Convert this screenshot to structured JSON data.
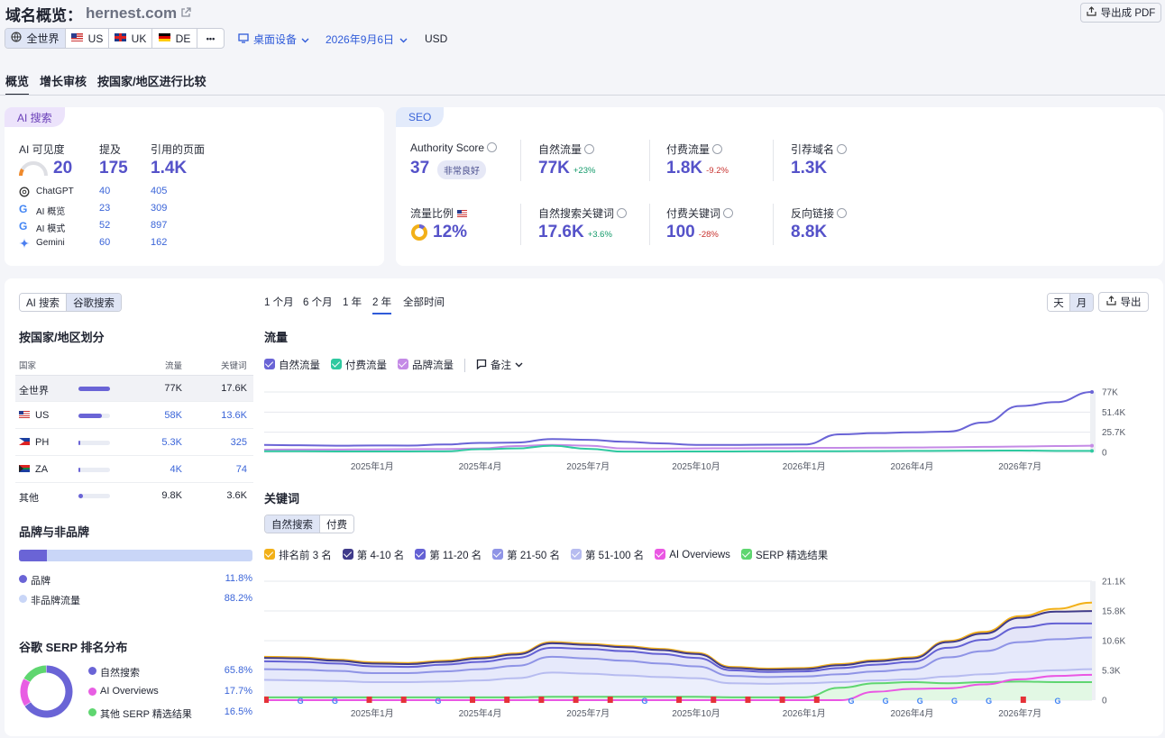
{
  "header": {
    "title": "域名概览：",
    "domain": "hernest.com",
    "export_pdf": "导出成 PDF",
    "regions": [
      "全世界",
      "US",
      "UK",
      "DE"
    ],
    "more": "•••",
    "device": "桌面设备",
    "date": "2026年9月6日",
    "currency": "USD"
  },
  "tabs": [
    "概览",
    "增长审核",
    "按国家/地区进行比较"
  ],
  "ai_card": {
    "tag": "AI 搜索",
    "col_visibility": "AI 可见度",
    "col_mentions": "提及",
    "col_pages": "引用的页面",
    "visibility": "20",
    "mentions": "175",
    "pages": "1.4K",
    "rows": [
      {
        "name": "ChatGPT",
        "mentions": "40",
        "pages": "405"
      },
      {
        "name": "AI 概览",
        "mentions": "23",
        "pages": "309"
      },
      {
        "name": "AI 模式",
        "mentions": "52",
        "pages": "897"
      },
      {
        "name": "Gemini",
        "mentions": "60",
        "pages": "162"
      }
    ]
  },
  "seo_card": {
    "tag": "SEO",
    "authority_label": "Authority Score",
    "authority_value": "37",
    "authority_badge": "非常良好",
    "organic_label": "自然流量",
    "organic_value": "77K",
    "organic_delta": "+23%",
    "paid_label": "付费流量",
    "paid_value": "1.8K",
    "paid_delta": "-9.2%",
    "refdomains_label": "引荐域名",
    "refdomains_value": "1.3K",
    "share_label": "流量比例",
    "share_value": "12%",
    "share_fraction": 0.12,
    "org_kw_label": "自然搜索关键词",
    "org_kw_value": "17.6K",
    "org_kw_delta": "+3.6%",
    "paid_kw_label": "付费关键词",
    "paid_kw_value": "100",
    "paid_kw_delta": "-28%",
    "backlinks_label": "反向链接",
    "backlinks_value": "8.8K"
  },
  "left_panel": {
    "toggle": [
      "AI 搜索",
      "谷歌搜索"
    ],
    "country_title": "按国家/地区划分",
    "col_country": "国家",
    "col_traffic": "流量",
    "col_keywords": "关键词",
    "countries": [
      {
        "name": "全世界",
        "traffic": "77K",
        "keywords": "17.6K",
        "share": 1.0
      },
      {
        "name": "US",
        "traffic": "58K",
        "keywords": "13.6K",
        "share": 0.75
      },
      {
        "name": "PH",
        "traffic": "5.3K",
        "keywords": "325",
        "share": 0.07
      },
      {
        "name": "ZA",
        "traffic": "4K",
        "keywords": "74",
        "share": 0.05
      },
      {
        "name": "其他",
        "traffic": "9.8K",
        "keywords": "3.6K",
        "share": 0.13
      }
    ],
    "brand_title": "品牌与非品牌",
    "brand_label": "品牌",
    "brand_value": "11.8%",
    "brand_fraction": 0.118,
    "nonbrand_label": "非品牌流量",
    "nonbrand_value": "88.2%",
    "serp_title": "谷歌 SERP 排名分布",
    "serp_items": [
      {
        "label": "自然搜索",
        "value": "65.8%",
        "fraction": 0.658,
        "color": "#6a64d6"
      },
      {
        "label": "AI Overviews",
        "value": "17.7%",
        "fraction": 0.177,
        "color": "#e85ee3"
      },
      {
        "label": "其他 SERP 精选结果",
        "value": "16.5%",
        "fraction": 0.165,
        "color": "#5fd670"
      }
    ]
  },
  "right_panel": {
    "ranges": [
      "1 个月",
      "6 个月",
      "1 年",
      "2 年",
      "全部时间"
    ],
    "active_range": "2 年",
    "gran_day": "天",
    "gran_month": "月",
    "export": "导出",
    "traffic_title": "流量",
    "traffic_legend": [
      "自然流量",
      "付费流量",
      "品牌流量"
    ],
    "notes": "备注",
    "kw_title": "关键词",
    "kw_toggle": [
      "自然搜索",
      "付费"
    ],
    "kw_legend": [
      "排名前 3 名",
      "第 4-10 名",
      "第 11-20 名",
      "第 21-50 名",
      "第 51-100 名",
      "AI Overviews",
      "SERP 精选结果"
    ]
  },
  "colors": {
    "organic": "#6a64d6",
    "paid": "#2fc9a0",
    "brand": "#c48ae6",
    "top3": "#f2b018",
    "pos4_10": "#3f3a8a",
    "pos11_20": "#6461d4",
    "pos21_50": "#8f94e6",
    "pos51_100": "#b7bcf0",
    "ai_overviews": "#ea57e3",
    "serp_features": "#5fd670"
  },
  "chart_data": [
    {
      "type": "line",
      "title": "流量",
      "x": [
        "2024年10月",
        "2024年11月",
        "2024年12月",
        "2025年1月",
        "2025年2月",
        "2025年3月",
        "2025年4月",
        "2025年5月",
        "2025年6月",
        "2025年7月",
        "2025年8月",
        "2025年9月",
        "2025年10月",
        "2025年11月",
        "2025年12月",
        "2026年1月",
        "2026年2月",
        "2026年3月",
        "2026年4月",
        "2026年5月",
        "2026年6月",
        "2026年7月",
        "2026年8月",
        "2026年9月"
      ],
      "x_tick_labels": [
        "2025年1月",
        "2025年4月",
        "2025年7月",
        "2025年10月",
        "2026年1月",
        "2026年4月",
        "2026年7月"
      ],
      "y_ticks": [
        "0",
        "25.7K",
        "51.4K",
        "77K"
      ],
      "ylim": [
        0,
        77000
      ],
      "series": [
        {
          "name": "自然流量",
          "values": [
            9500,
            9000,
            8500,
            8800,
            8600,
            10000,
            12000,
            12500,
            17000,
            16000,
            13500,
            11500,
            9500,
            9500,
            9800,
            10000,
            23000,
            24500,
            25500,
            26500,
            38000,
            59000,
            64000,
            77000
          ]
        },
        {
          "name": "付费流量",
          "values": [
            1500,
            1400,
            1200,
            1200,
            1200,
            1300,
            4000,
            5000,
            8500,
            4500,
            1000,
            1000,
            1200,
            1200,
            1300,
            1400,
            1500,
            1600,
            1800,
            2000,
            2200,
            2300,
            1900,
            1800
          ]
        },
        {
          "name": "品牌流量",
          "values": [
            3500,
            3600,
            3600,
            3800,
            4000,
            4200,
            5000,
            8000,
            9500,
            8500,
            5000,
            4800,
            5000,
            5200,
            5400,
            5600,
            5800,
            6000,
            6200,
            6500,
            7000,
            7500,
            8000,
            8500
          ]
        }
      ]
    },
    {
      "type": "area",
      "title": "关键词",
      "x": [
        "2024年10月",
        "2024年11月",
        "2024年12月",
        "2025年1月",
        "2025年2月",
        "2025年3月",
        "2025年4月",
        "2025年5月",
        "2025年6月",
        "2025年7月",
        "2025年8月",
        "2025年9月",
        "2025年10月",
        "2025年11月",
        "2025年12月",
        "2026年1月",
        "2026年2月",
        "2026年3月",
        "2026年4月",
        "2026年5月",
        "2026年6月",
        "2026年7月",
        "2026年8月",
        "2026年9月"
      ],
      "x_tick_labels": [
        "2025年1月",
        "2025年4月",
        "2025年7月",
        "2025年10月",
        "2026年1月",
        "2026年4月",
        "2026年7月"
      ],
      "y_ticks": [
        "0",
        "5.3K",
        "10.6K",
        "15.8K",
        "21.1K"
      ],
      "ylim": [
        0,
        21100
      ],
      "series": [
        {
          "name": "排名前 3 名",
          "values": [
            7700,
            7600,
            7200,
            6700,
            6600,
            7000,
            7600,
            8300,
            10300,
            10000,
            9600,
            9100,
            8400,
            5900,
            5600,
            5700,
            6400,
            7100,
            7600,
            10500,
            12100,
            14900,
            16200,
            17300
          ]
        },
        {
          "name": "第 4-10 名",
          "values": [
            7500,
            7400,
            7000,
            6500,
            6400,
            6800,
            7400,
            8100,
            10100,
            9800,
            9400,
            8900,
            8200,
            5700,
            5400,
            5500,
            6200,
            6900,
            7400,
            10300,
            11800,
            14600,
            15700,
            15800
          ]
        },
        {
          "name": "第 11-20 名",
          "values": [
            6900,
            6800,
            6500,
            6000,
            5900,
            6300,
            6800,
            7500,
            9300,
            9100,
            8700,
            8200,
            7500,
            5300,
            5000,
            5100,
            5700,
            6300,
            6800,
            9300,
            10700,
            12900,
            13600,
            13600
          ]
        },
        {
          "name": "第 21-50 名",
          "values": [
            5500,
            5400,
            5200,
            4800,
            4800,
            5100,
            5500,
            6100,
            7700,
            7400,
            7000,
            6500,
            6000,
            4300,
            4100,
            4200,
            4600,
            5100,
            5500,
            7600,
            8700,
            10300,
            10800,
            11100
          ]
        },
        {
          "name": "第 51-100 名",
          "values": [
            3600,
            3500,
            3400,
            3200,
            3200,
            3300,
            3500,
            3900,
            4900,
            4700,
            4400,
            4100,
            3900,
            3000,
            2900,
            3000,
            3200,
            3500,
            3700,
            4200,
            4600,
            5000,
            5300,
            5500
          ]
        },
        {
          "name": "AI Overviews",
          "values": [
            0,
            0,
            0,
            0,
            0,
            0,
            0,
            0,
            0,
            0,
            0,
            0,
            0,
            0,
            0,
            0,
            0,
            1500,
            2000,
            2100,
            2800,
            3700,
            4300,
            4500
          ]
        },
        {
          "name": "SERP 精选结果",
          "values": [
            500,
            500,
            500,
            500,
            500,
            500,
            500,
            500,
            600,
            600,
            600,
            600,
            600,
            500,
            500,
            500,
            2200,
            3000,
            3200,
            3000,
            3200,
            3300,
            3200,
            3200
          ]
        }
      ]
    }
  ]
}
